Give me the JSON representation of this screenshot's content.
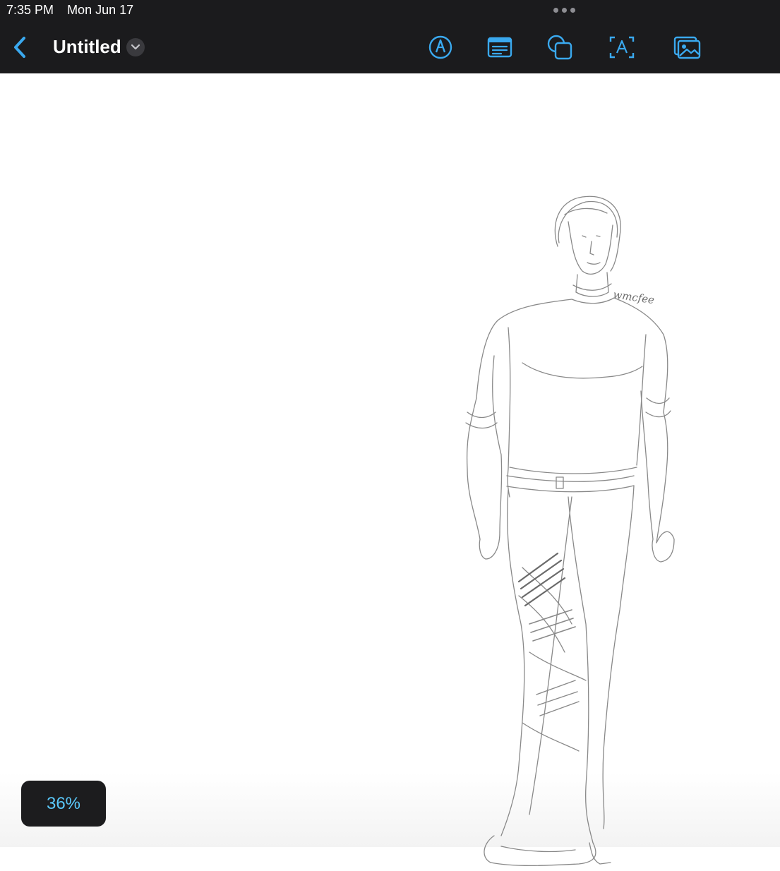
{
  "status_bar": {
    "time": "7:35 PM",
    "date": "Mon Jun 17"
  },
  "header": {
    "title": "Untitled",
    "back_icon": "chevron-left-icon",
    "title_menu_icon": "chevron-down-icon"
  },
  "toolbar": {
    "tools": [
      "pencil-tool-icon",
      "text-box-icon",
      "shapes-icon",
      "text-icon",
      "photo-icon"
    ],
    "accent_color": "#3aa9ef"
  },
  "canvas": {
    "signature": "wmcfee"
  },
  "zoom": {
    "level": "36%"
  }
}
